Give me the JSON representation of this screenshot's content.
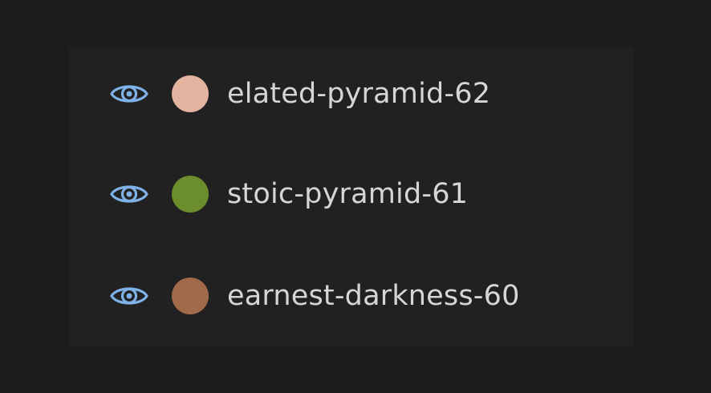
{
  "runs": [
    {
      "name": "elated-pyramid-62",
      "color": "#e3b3a0",
      "visible": true,
      "visibility_icon": "eye-icon"
    },
    {
      "name": "stoic-pyramid-61",
      "color": "#6b8d2b",
      "visible": true,
      "visibility_icon": "eye-icon"
    },
    {
      "name": "earnest-darkness-60",
      "color": "#a16b4b",
      "visible": true,
      "visibility_icon": "eye-icon"
    }
  ],
  "colors": {
    "background": "#1c1c1c",
    "panel": "#212121",
    "text": "#d6d6d6",
    "eye_icon": "#7fb2e8"
  }
}
